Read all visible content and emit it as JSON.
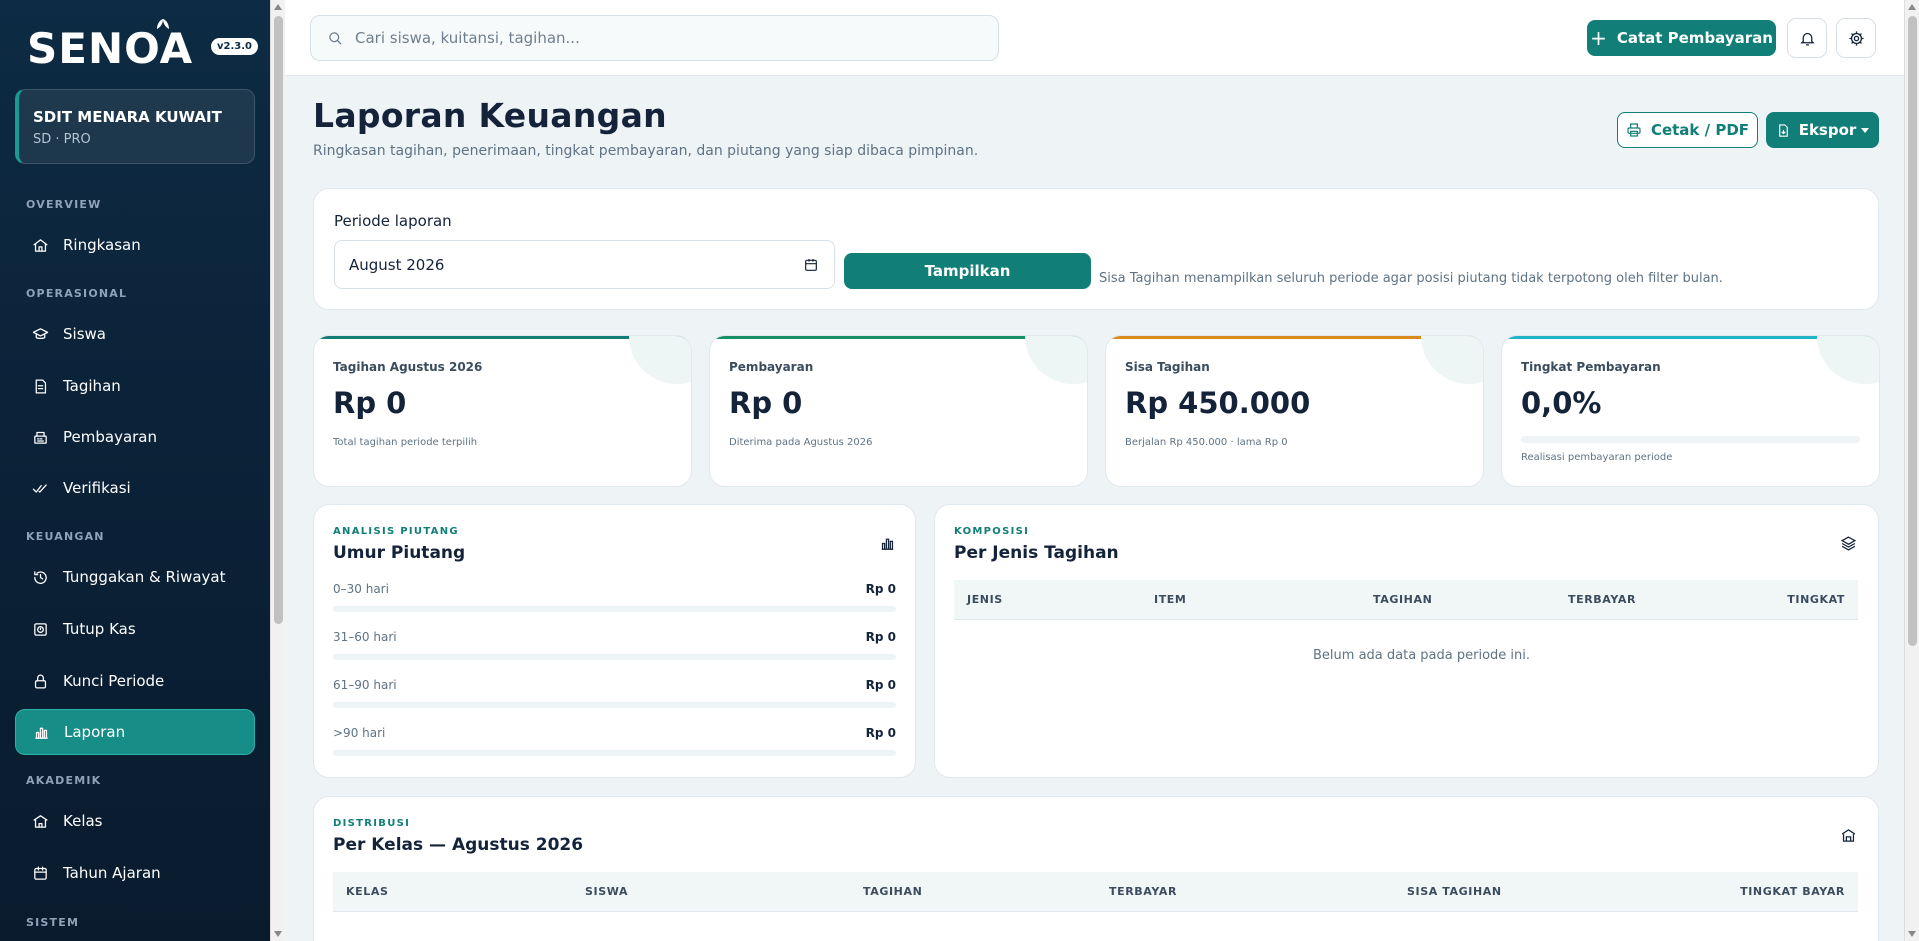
{
  "brand": {
    "name": "SENOA",
    "version": "v2.3.0"
  },
  "school": {
    "name": "SDIT MENARA KUWAIT",
    "sub": "SD · PRO"
  },
  "sidebar": {
    "sections": [
      "OVERVIEW",
      "OPERASIONAL",
      "KEUANGAN",
      "AKADEMIK",
      "SISTEM"
    ],
    "items": [
      {
        "label": "Ringkasan",
        "icon": "home-icon"
      },
      {
        "label": "Siswa",
        "icon": "graduation-cap-icon"
      },
      {
        "label": "Tagihan",
        "icon": "invoice-icon"
      },
      {
        "label": "Pembayaran",
        "icon": "register-icon"
      },
      {
        "label": "Verifikasi",
        "icon": "double-check-icon"
      },
      {
        "label": "Tunggakan & Riwayat",
        "icon": "history-icon"
      },
      {
        "label": "Tutup Kas",
        "icon": "safe-icon"
      },
      {
        "label": "Kunci Periode",
        "icon": "lock-icon"
      },
      {
        "label": "Laporan",
        "icon": "bar-chart-icon"
      },
      {
        "label": "Kelas",
        "icon": "school-icon"
      },
      {
        "label": "Tahun Ajaran",
        "icon": "calendar-icon"
      }
    ]
  },
  "topbar": {
    "search_placeholder": "Cari siswa, kuitansi, tagihan...",
    "primary_button": "Catat Pembayaran"
  },
  "header": {
    "title": "Laporan Keuangan",
    "subtitle": "Ringkasan tagihan, penerimaan, tingkat pembayaran, dan piutang yang siap dibaca pimpinan.",
    "print_button": "Cetak / PDF",
    "export_button": "Ekspor"
  },
  "period": {
    "label": "Periode laporan",
    "value": "August 2026",
    "show_button": "Tampilkan",
    "note": "Sisa Tagihan menampilkan seluruh periode agar posisi piutang tidak terpotong oleh filter bulan."
  },
  "kpis": [
    {
      "label": "Tagihan Agustus 2026",
      "value": "Rp 0",
      "note": "Total tagihan periode terpilih",
      "accent": "#117e78"
    },
    {
      "label": "Pembayaran",
      "value": "Rp 0",
      "note": "Diterima pada Agustus 2026",
      "accent": "#17906a"
    },
    {
      "label": "Sisa Tagihan",
      "value": "Rp 450.000",
      "note": "Berjalan Rp 450.000 · lama Rp 0",
      "accent": "#d98a1c"
    },
    {
      "label": "Tingkat Pembayaran",
      "value": "0,0%",
      "note": "Realisasi pembayaran periode",
      "accent": "#22b3c6",
      "progress": 0
    }
  ],
  "aging": {
    "eyebrow": "ANALISIS PIUTANG",
    "title": "Umur Piutang",
    "rows": [
      {
        "label": "0–30 hari",
        "value": "Rp 0"
      },
      {
        "label": "31–60 hari",
        "value": "Rp 0"
      },
      {
        "label": "61–90 hari",
        "value": "Rp 0"
      },
      {
        "label": ">90 hari",
        "value": "Rp 0"
      }
    ]
  },
  "composition": {
    "eyebrow": "KOMPOSISI",
    "title": "Per Jenis Tagihan",
    "columns": [
      "JENIS",
      "ITEM",
      "TAGIHAN",
      "TERBAYAR",
      "TINGKAT"
    ],
    "empty": "Belum ada data pada periode ini."
  },
  "distribution": {
    "eyebrow": "DISTRIBUSI",
    "title": "Per Kelas — Agustus 2026",
    "columns": [
      "KELAS",
      "SISWA",
      "TAGIHAN",
      "TERBAYAR",
      "SISA TAGIHAN",
      "TINGKAT BAYAR"
    ]
  },
  "colors": {
    "primary": "#117e78",
    "sidebar": "#0d2b44",
    "accent_teal": "#1b9a92"
  }
}
